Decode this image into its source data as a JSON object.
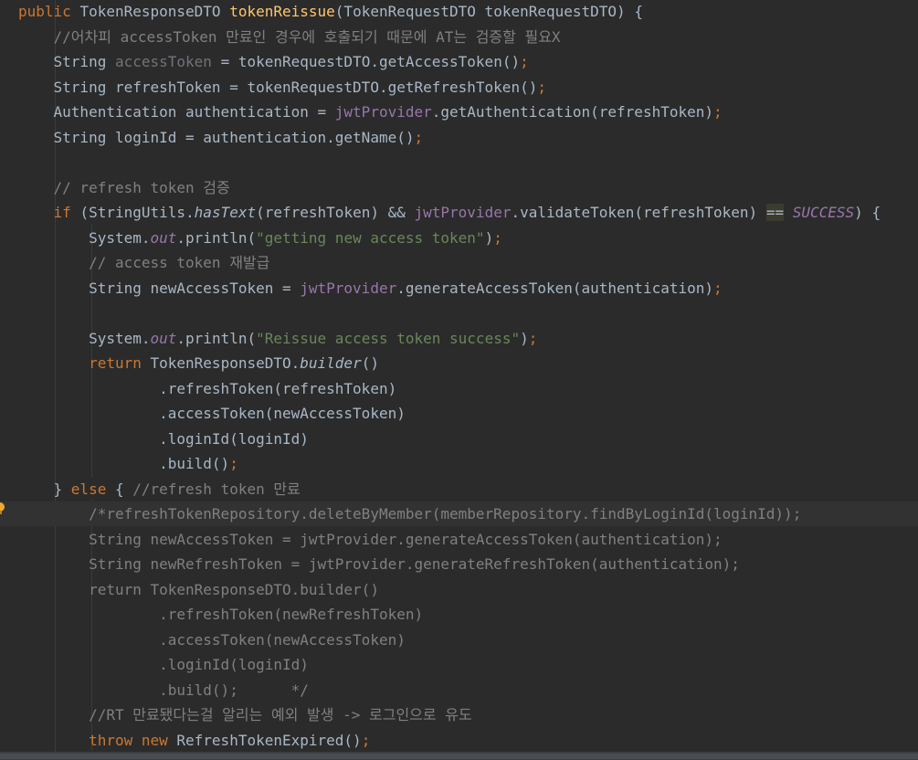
{
  "colors": {
    "background": "#2b2b2b",
    "keyword": "#cc7832",
    "method_decl": "#ffc66d",
    "field": "#9876aa",
    "string": "#6a8759",
    "comment": "#808080",
    "plain": "#a9b7c6",
    "unused": "#72737a"
  },
  "code_lines": [
    [
      {
        "t": "public ",
        "c": "kw"
      },
      {
        "t": "TokenResponseDTO ",
        "c": "plain"
      },
      {
        "t": "tokenReissue",
        "c": "fn"
      },
      {
        "t": "(TokenRequestDTO tokenRequestDTO) {",
        "c": "plain"
      }
    ],
    [
      {
        "t": "    //어차피 accessToken 만료인 경우에 호출되기 때문에 AT는 검증할 필요X",
        "c": "comment"
      }
    ],
    [
      {
        "t": "    String ",
        "c": "plain"
      },
      {
        "t": "accessToken",
        "c": "unused"
      },
      {
        "t": " = tokenRequestDTO.getAccessToken()",
        "c": "plain"
      },
      {
        "t": ";",
        "c": "kw"
      }
    ],
    [
      {
        "t": "    String refreshToken = tokenRequestDTO.getRefreshToken()",
        "c": "plain"
      },
      {
        "t": ";",
        "c": "kw"
      }
    ],
    [
      {
        "t": "    Authentication authentication = ",
        "c": "plain"
      },
      {
        "t": "jwtProvider",
        "c": "field"
      },
      {
        "t": ".getAuthentication(refreshToken)",
        "c": "plain"
      },
      {
        "t": ";",
        "c": "kw"
      }
    ],
    [
      {
        "t": "    String loginId = authentication.getName()",
        "c": "plain"
      },
      {
        "t": ";",
        "c": "kw"
      }
    ],
    [
      {
        "t": "",
        "c": "plain"
      }
    ],
    [
      {
        "t": "    // refresh token 검증",
        "c": "comment"
      }
    ],
    [
      {
        "t": "    ",
        "c": "plain"
      },
      {
        "t": "if ",
        "c": "kw"
      },
      {
        "t": "(StringUtils.",
        "c": "plain"
      },
      {
        "t": "hasText",
        "c": "plain italic"
      },
      {
        "t": "(refreshToken) && ",
        "c": "plain"
      },
      {
        "t": "jwtProvider",
        "c": "field"
      },
      {
        "t": ".validateToken(refreshToken) ",
        "c": "plain"
      },
      {
        "t": "==",
        "c": "hl"
      },
      {
        "t": " ",
        "c": "plain"
      },
      {
        "t": "SUCCESS",
        "c": "field italic"
      },
      {
        "t": ") {",
        "c": "plain"
      }
    ],
    [
      {
        "t": "        System.",
        "c": "plain"
      },
      {
        "t": "out",
        "c": "field italic"
      },
      {
        "t": ".println(",
        "c": "plain"
      },
      {
        "t": "\"getting new access token\"",
        "c": "str"
      },
      {
        "t": ")",
        "c": "plain"
      },
      {
        "t": ";",
        "c": "kw"
      }
    ],
    [
      {
        "t": "        // access token 재발급",
        "c": "comment"
      }
    ],
    [
      {
        "t": "        String newAccessToken = ",
        "c": "plain"
      },
      {
        "t": "jwtProvider",
        "c": "field"
      },
      {
        "t": ".generateAccessToken(authentication)",
        "c": "plain"
      },
      {
        "t": ";",
        "c": "kw"
      }
    ],
    [
      {
        "t": "",
        "c": "plain"
      }
    ],
    [
      {
        "t": "        System.",
        "c": "plain"
      },
      {
        "t": "out",
        "c": "field italic"
      },
      {
        "t": ".println(",
        "c": "plain"
      },
      {
        "t": "\"Reissue access token success\"",
        "c": "str"
      },
      {
        "t": ")",
        "c": "plain"
      },
      {
        "t": ";",
        "c": "kw"
      }
    ],
    [
      {
        "t": "        ",
        "c": "plain"
      },
      {
        "t": "return ",
        "c": "kw"
      },
      {
        "t": "TokenResponseDTO.",
        "c": "plain"
      },
      {
        "t": "builder",
        "c": "plain italic"
      },
      {
        "t": "()",
        "c": "plain"
      }
    ],
    [
      {
        "t": "                .refreshToken(refreshToken)",
        "c": "plain"
      }
    ],
    [
      {
        "t": "                .accessToken(newAccessToken)",
        "c": "plain"
      }
    ],
    [
      {
        "t": "                .loginId(loginId)",
        "c": "plain"
      }
    ],
    [
      {
        "t": "                .build()",
        "c": "plain"
      },
      {
        "t": ";",
        "c": "kw"
      }
    ],
    [
      {
        "t": "    } ",
        "c": "plain"
      },
      {
        "t": "else ",
        "c": "kw"
      },
      {
        "t": "{ ",
        "c": "plain"
      },
      {
        "t": "//refresh token 만료",
        "c": "comment"
      }
    ],
    [
      {
        "t": "        /*refreshTokenRepository.deleteByMember(memberRepository.findByLoginId(loginId));",
        "c": "comment"
      }
    ],
    [
      {
        "t": "        String newAccessToken = jwtProvider.generateAccessToken(authentication);",
        "c": "comment"
      }
    ],
    [
      {
        "t": "        String newRefreshToken = jwtProvider.generateRefreshToken(authentication);",
        "c": "comment"
      }
    ],
    [
      {
        "t": "        return TokenResponseDTO.builder()",
        "c": "comment"
      }
    ],
    [
      {
        "t": "                .refreshToken(newRefreshToken)",
        "c": "comment"
      }
    ],
    [
      {
        "t": "                .accessToken(newAccessToken)",
        "c": "comment"
      }
    ],
    [
      {
        "t": "                .loginId(loginId)",
        "c": "comment"
      }
    ],
    [
      {
        "t": "                .build();      */",
        "c": "comment"
      }
    ],
    [
      {
        "t": "        //RT 만료됐다는걸 알리는 예외 발생 -> 로그인으로 유도",
        "c": "comment"
      }
    ],
    [
      {
        "t": "        ",
        "c": "plain"
      },
      {
        "t": "throw new ",
        "c": "kw"
      },
      {
        "t": "RefreshTokenExpired()",
        "c": "plain"
      },
      {
        "t": ";",
        "c": "kw"
      }
    ]
  ]
}
